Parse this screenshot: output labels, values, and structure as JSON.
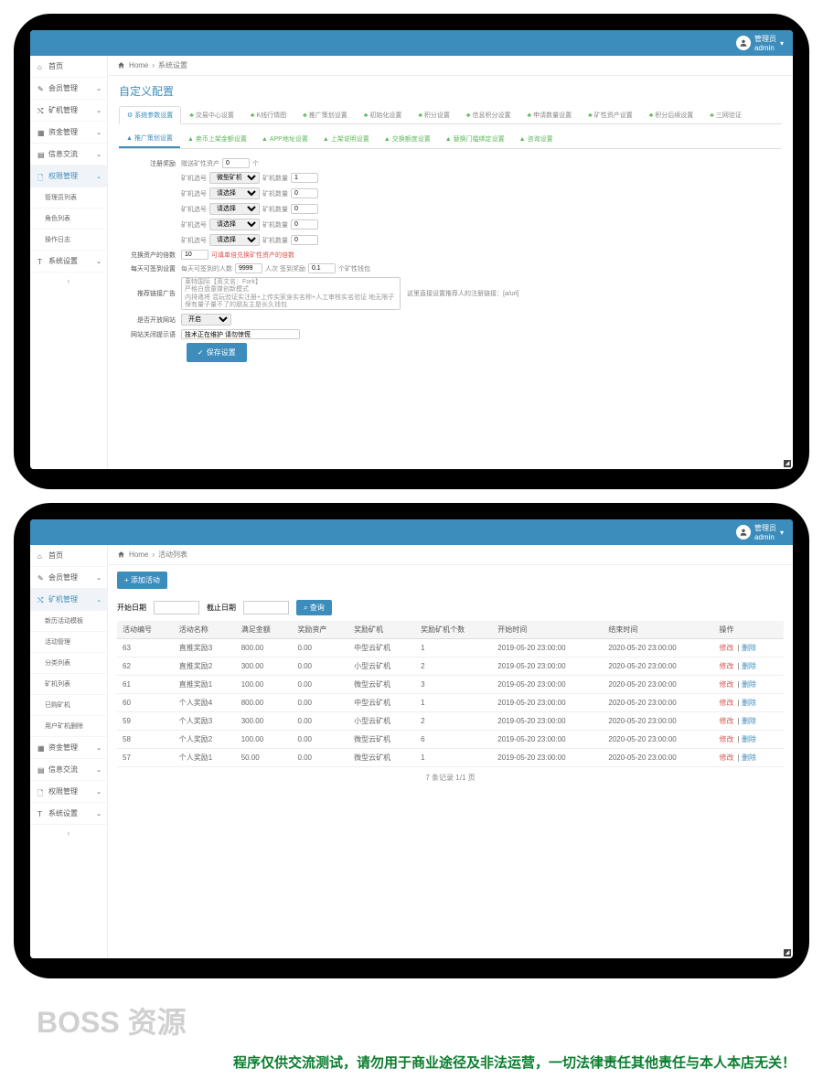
{
  "user": {
    "role": "管理员",
    "name": "admin"
  },
  "screen1": {
    "breadcrumb": {
      "home": "Home",
      "current": "系统设置"
    },
    "sidebar": [
      {
        "icon": "home",
        "label": "首页",
        "chev": false
      },
      {
        "icon": "edit",
        "label": "会员管理",
        "chev": true
      },
      {
        "icon": "random",
        "label": "矿机管理",
        "chev": true
      },
      {
        "icon": "cal",
        "label": "资金管理",
        "chev": true
      },
      {
        "icon": "book",
        "label": "信息交流",
        "chev": true
      },
      {
        "icon": "file",
        "label": "权限管理",
        "chev": true,
        "active": true
      },
      {
        "sub": true,
        "label": "管理员列表"
      },
      {
        "sub": true,
        "label": "角色列表"
      },
      {
        "sub": true,
        "label": "操作日志"
      },
      {
        "icon": "text",
        "label": "系统设置",
        "chev": true
      }
    ],
    "title": "自定义配置",
    "tabs": [
      "系统参数设置",
      "交易中心设置",
      "K线行情图",
      "推广策划设置",
      "初始化设置",
      "积分设置",
      "信息积分设置",
      "申请数量设置",
      "矿性资产设置",
      "积分后续设置",
      "三网验证"
    ],
    "subtabs": [
      "推广策划设置",
      "卖币上架金额设置",
      "APP地址设置",
      "上架说明设置",
      "交换额度设置",
      "替换门槛绑定设置",
      "咨询设置"
    ],
    "form": {
      "row1": {
        "label": "注册奖励",
        "prefix": "赠送矿性资产",
        "value": "0",
        "unit": "个"
      },
      "machines": [
        {
          "typeLabel": "矿机选号",
          "type": "微型矿机（赠",
          "countLabel": "矿机数量",
          "count": "1"
        },
        {
          "typeLabel": "矿机选号",
          "type": "请选择",
          "countLabel": "矿机数量",
          "count": "0"
        },
        {
          "typeLabel": "矿机选号",
          "type": "请选择",
          "countLabel": "矿机数量",
          "count": "0"
        },
        {
          "typeLabel": "矿机选号",
          "type": "请选择",
          "countLabel": "矿机数量",
          "count": "0"
        },
        {
          "typeLabel": "矿机选号",
          "type": "请选择",
          "countLabel": "矿机数量",
          "count": "0"
        }
      ],
      "row_exchange": {
        "label": "兑换资产的倍数",
        "value": "10",
        "note": "可填单倍兑换矿性资产的倍数"
      },
      "row_daily": {
        "label": "每天可签到设置",
        "prefix": "每天可签到的人数",
        "count": "9999",
        "unit1": "人次 签到奖励",
        "reward": "0.1",
        "unit2": "个矿性钱包"
      },
      "row_promo": {
        "label": "推荐链接广告",
        "placeholder": "莱特国际【英文名：Fork】\n严格白盘童媒创新模式\n内排遣将 混玩验证实注册+上传实家身实名称+人工审核实名验证 地无限子\n保有量子量不了的朋友主是长久钱包",
        "hint": "这里直接设置推荐人的注册链接：[a/url]"
      },
      "row_open": {
        "label": "是否开放网站",
        "value": "开启"
      },
      "row_closed": {
        "label": "网站关闭提示语",
        "value": "技术正在维护 请勿惊慌"
      },
      "save": "保存设置"
    }
  },
  "screen2": {
    "breadcrumb": {
      "home": "Home",
      "current": "活动列表"
    },
    "sidebar": [
      {
        "icon": "home",
        "label": "首页",
        "chev": false
      },
      {
        "icon": "edit",
        "label": "会员管理",
        "chev": true
      },
      {
        "icon": "random",
        "label": "矿机管理",
        "chev": true,
        "active": true
      },
      {
        "sub": true,
        "label": "新历活动模板"
      },
      {
        "sub": true,
        "label": "活动管理"
      },
      {
        "sub": true,
        "label": "分类列表"
      },
      {
        "sub": true,
        "label": "矿机列表"
      },
      {
        "sub": true,
        "label": "已购矿机"
      },
      {
        "sub": true,
        "label": "用户矿机删除"
      },
      {
        "icon": "cal",
        "label": "资金管理",
        "chev": true
      },
      {
        "icon": "book",
        "label": "信息交流",
        "chev": true
      },
      {
        "icon": "file",
        "label": "权限管理",
        "chev": true
      },
      {
        "icon": "text",
        "label": "系统设置",
        "chev": true
      }
    ],
    "addBtn": "+ 添加活动",
    "filter": {
      "startLabel": "开始日期",
      "endLabel": "截止日期",
      "search": "查询"
    },
    "columns": [
      "活动编号",
      "活动名称",
      "满足金额",
      "奖励资产",
      "奖励矿机",
      "奖励矿机个数",
      "开始时间",
      "结束时间",
      "操作"
    ],
    "rows": [
      [
        "63",
        "直推奖励3",
        "800.00",
        "0.00",
        "中型云矿机",
        "1",
        "2019-05-20 23:00:00",
        "2020-05-20 23:00:00"
      ],
      [
        "62",
        "直推奖励2",
        "300.00",
        "0.00",
        "小型云矿机",
        "2",
        "2019-05-20 23:00:00",
        "2020-05-20 23:00:00"
      ],
      [
        "61",
        "直推奖励1",
        "100.00",
        "0.00",
        "微型云矿机",
        "3",
        "2019-05-20 23:00:00",
        "2020-05-20 23:00:00"
      ],
      [
        "60",
        "个人奖励4",
        "800.00",
        "0.00",
        "中型云矿机",
        "1",
        "2019-05-20 23:00:00",
        "2020-05-20 23:00:00"
      ],
      [
        "59",
        "个人奖励3",
        "300.00",
        "0.00",
        "小型云矿机",
        "2",
        "2019-05-20 23:00:00",
        "2020-05-20 23:00:00"
      ],
      [
        "58",
        "个人奖励2",
        "100.00",
        "0.00",
        "微型云矿机",
        "6",
        "2019-05-20 23:00:00",
        "2020-05-20 23:00:00"
      ],
      [
        "57",
        "个人奖励1",
        "50.00",
        "0.00",
        "微型云矿机",
        "1",
        "2019-05-20 23:00:00",
        "2020-05-20 23:00:00"
      ]
    ],
    "ops": {
      "edit": "修改",
      "del": "删除"
    },
    "pager": "7 条记录 1/1 页"
  },
  "watermark": "BOSS 资源",
  "disclaimer": "程序仅供交流测试，请勿用于商业途径及非法运营，一切法律责任其他责任与本人本店无关！"
}
